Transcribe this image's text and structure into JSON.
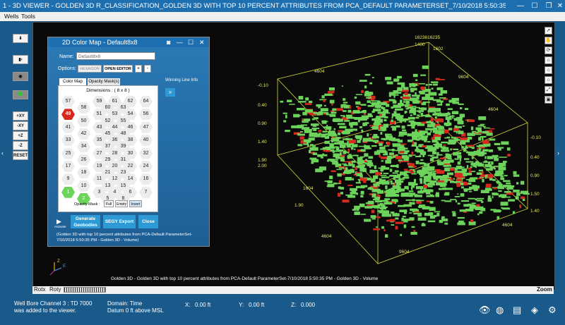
{
  "window": {
    "title": "1 - 3D VIEWER - GOLDEN 3D R_CLASSIFICATION_GOLDEN 3D WITH TOP 10 PERCENT ATTRIBUTES FROM PCA_DEFAULT PARAMETERSET_7/10/2018 5:50:35 PM - GOLDEN 3D - ..."
  },
  "menu": [
    "Wells",
    "Tools"
  ],
  "left_toolbar": {
    "xy_pos": "+XY",
    "xy_neg": "-XY",
    "z_pos": "+Z",
    "z_neg": "-Z",
    "reset": "RESET"
  },
  "dialog": {
    "title": "2D Color Map - Default8x8",
    "name_label": "Name:",
    "name_value": "Default8x8",
    "options_label": "Options:",
    "options_value": "HEXAGON",
    "open_editor": "OPEN EDITOR",
    "plus": "+",
    "minus": "-",
    "tabs": [
      "Color Map",
      "Opacity Mask(s)"
    ],
    "dimensions": "Dimensions : ( 8 x 8 )",
    "winning_line": "Winning Line Info",
    "opacity_mask_label": "Opacity Mask :",
    "mask_full": "Full",
    "mask_empty": "Empty",
    "mask_invert": "Invert",
    "animate": "Animate",
    "generate": "Generate Geobodies",
    "segy_export": "SEGY Export",
    "close": "Close",
    "info": "(Golden 3D with top 10 percent attributes from PCA-Default ParameterSet-7/10/2018 5:50:35 PM - Golden 3D - Volume)",
    "hex_rows": [
      [
        57,
        59,
        61,
        62,
        64
      ],
      [
        58,
        60,
        63
      ],
      [
        49,
        51,
        53,
        54,
        56
      ],
      [
        50,
        52,
        55
      ],
      [
        41,
        43,
        44,
        46,
        47
      ],
      [
        42,
        45,
        48
      ],
      [
        33,
        35,
        36,
        38,
        40
      ],
      [
        34,
        37,
        39
      ],
      [
        25,
        27,
        28,
        30,
        32
      ],
      [
        26,
        29,
        31
      ],
      [
        17,
        19,
        20,
        22,
        24
      ],
      [
        18,
        21,
        23
      ],
      [
        9,
        11,
        12,
        14,
        16
      ],
      [
        10,
        13,
        15
      ],
      [
        1,
        3,
        4,
        6,
        7
      ],
      [
        2,
        5,
        8
      ]
    ]
  },
  "viewer": {
    "caption": "Golden 3D - Golden 3D with top 10 percent attributes from PCA-Default ParameterSet-7/10/2018 5:50:35 PM - Golden 3D - Volume",
    "axis_labels": [
      "1623616235",
      "1400",
      "1602",
      "-0.10",
      "0.40",
      "0.90",
      "1.40",
      "1.90",
      "2.00",
      "4604",
      "9604",
      "4604",
      "-0.10",
      "0.40",
      "0.90",
      "1.40",
      "1.50",
      "1.90",
      "4604",
      "9604",
      "4604",
      "1604"
    ],
    "rotx": "Rotx",
    "roty": "Roty",
    "zoom": "Zoom"
  },
  "status": {
    "message": "Well Bore Channel 3 : TD 7000 was added to the viewer.",
    "domain": "Domain: Time",
    "datum": "Datum 0 ft above MSL",
    "x": "X:",
    "x_val": "0.00 ft",
    "y": "Y:",
    "y_val": "0.00 ft",
    "z": "Z:",
    "z_val": "0.000"
  },
  "colors": {
    "accent": "#1e6fb0",
    "green": "#6cd45a",
    "red": "#d72a1e",
    "axis": "#e8e85a"
  }
}
